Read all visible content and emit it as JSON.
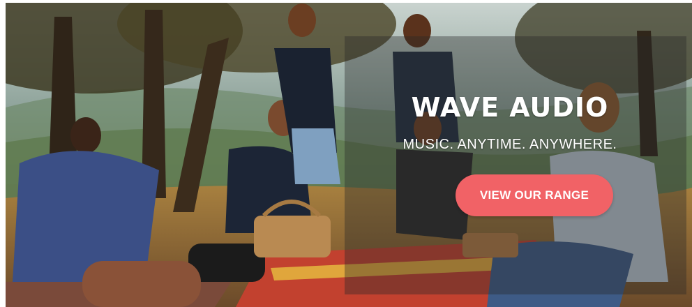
{
  "hero": {
    "title": "WAVE AUDIO",
    "tagline": "MUSIC. ANYTIME. ANYWHERE.",
    "cta_label": "VIEW OUR RANGE",
    "cta_color": "#f16266",
    "scene": "Friends picnicking under trees on a hillside with a portable speaker"
  }
}
